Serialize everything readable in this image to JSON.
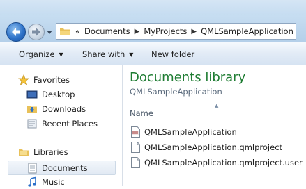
{
  "address_bar": {
    "overflow": "«",
    "segments": [
      "Documents",
      "MyProjects",
      "QMLSampleApplication"
    ]
  },
  "toolbar": {
    "organize": "Organize",
    "share_with": "Share with",
    "new_folder": "New folder"
  },
  "nav": {
    "favorites": "Favorites",
    "desktop": "Desktop",
    "downloads": "Downloads",
    "recent_places": "Recent Places",
    "libraries": "Libraries",
    "documents": "Documents",
    "music": "Music"
  },
  "content": {
    "title": "Documents library",
    "subtitle": "QMLSampleApplication",
    "column_name": "Name",
    "files": [
      {
        "name": "QMLSampleApplication",
        "icon": "qml-icon"
      },
      {
        "name": "QMLSampleApplication.qmlproject",
        "icon": "file-icon"
      },
      {
        "name": "QMLSampleApplication.qmlproject.user",
        "icon": "file-icon"
      }
    ]
  },
  "colors": {
    "library_title": "#1e7c32",
    "titlebar": "#c6ddf1",
    "toolbar": "#e2ebf6"
  }
}
